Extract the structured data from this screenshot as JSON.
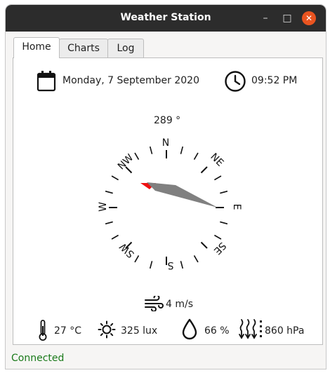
{
  "window": {
    "title": "Weather Station",
    "minimize_glyph": "–",
    "maximize_glyph": "□",
    "close_glyph": "✕"
  },
  "tabs": [
    {
      "label": "Home",
      "active": true
    },
    {
      "label": "Charts",
      "active": false
    },
    {
      "label": "Log",
      "active": false
    }
  ],
  "home": {
    "date": "Monday, 7 September 2020",
    "time": "09:52 PM",
    "compass": {
      "heading_label": "289 °",
      "heading_deg": 289,
      "labels": {
        "n": "N",
        "ne": "NE",
        "e": "E",
        "se": "SE",
        "s": "S",
        "sw": "SW",
        "w": "W",
        "nw": "NW"
      }
    },
    "wind_speed": "4 m/s",
    "temperature": "27 °C",
    "light": "325 lux",
    "humidity": "66 %",
    "pressure": "860 hPa"
  },
  "status": "Connected",
  "icons": {
    "calendar": "calendar-icon",
    "clock": "clock-icon",
    "wind": "wind-icon",
    "thermometer": "thermometer-icon",
    "sun": "sun-icon",
    "drop": "drop-icon",
    "pressure": "pressure-icon"
  },
  "colors": {
    "needle_north": "#ee1111",
    "needle_south": "#808080",
    "status": "#1a7a1a",
    "close_button": "#e95420"
  }
}
